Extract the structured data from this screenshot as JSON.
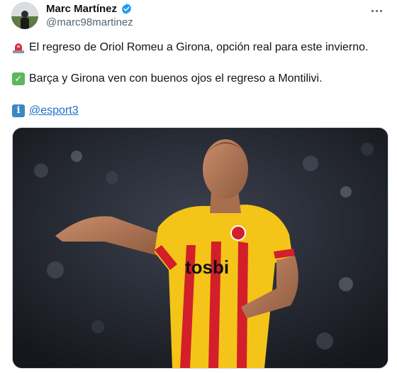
{
  "author": {
    "display_name": "Marc Martínez",
    "handle": "@marc98martinez",
    "verified_color": "#1d9bf0"
  },
  "tweet": {
    "line1": "El regreso de Oriol Romeu a Girona, opción real para este invierno.",
    "line1_icon": "police-siren-emoji",
    "line2": "Barça y Girona ven con buenos ojos el regreso a Montilivi.",
    "line2_icon": "check-mark-emoji",
    "line3_icon": "information-emoji",
    "mention": "@esport3"
  },
  "media": {
    "jersey_text": "tosbi",
    "jersey_colors": [
      "#f5c419",
      "#d21f2a"
    ]
  },
  "colors": {
    "link": "#1d70c9",
    "secondary_text": "#536471"
  }
}
